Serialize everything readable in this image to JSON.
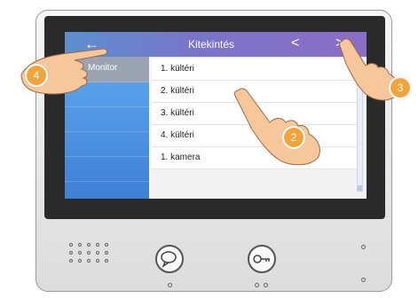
{
  "header": {
    "title": "Kitekintés",
    "back_glyph": "←",
    "prev_glyph": "<",
    "next_glyph": ">"
  },
  "sidebar": {
    "items": [
      {
        "label": "Monitor",
        "icon": "monitor-icon",
        "active": true
      }
    ]
  },
  "list": {
    "items": [
      {
        "label": "1. kültéri"
      },
      {
        "label": "2. kültéri"
      },
      {
        "label": "3. kültéri"
      },
      {
        "label": "4. kültéri"
      },
      {
        "label": "1. kamera"
      }
    ]
  },
  "annotations": {
    "step_back": "4",
    "step_select": "2",
    "step_next": "3"
  },
  "colors": {
    "header_gradient_start": "#5b8fd0",
    "header_gradient_end": "#8b6ec6",
    "sidebar_blue": "#3e7fd6",
    "badge_orange": "#f2a33a"
  }
}
